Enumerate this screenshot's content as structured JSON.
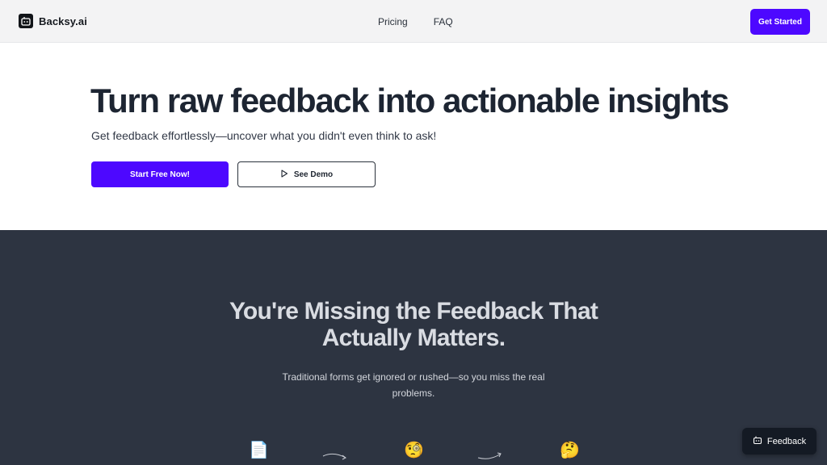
{
  "header": {
    "brand": "Backsy.ai",
    "nav": [
      "Pricing",
      "FAQ"
    ],
    "cta": "Get Started"
  },
  "hero": {
    "title": "Turn raw feedback into actionable insights",
    "subtitle": "Get feedback effortlessly—uncover what you didn't even think to ask!",
    "primary_button": "Start Free Now!",
    "secondary_button": "See Demo"
  },
  "problem": {
    "title_line1": "You're Missing the Feedback That",
    "title_line2": "Actually Matters.",
    "subtitle_line1": "Traditional forms get ignored or rushed—so you miss the real",
    "subtitle_line2": "problems.",
    "emojis": [
      "📄",
      "🧐",
      "🤔"
    ]
  },
  "floating": {
    "feedback_button": "Feedback"
  },
  "colors": {
    "accent": "#4d08ff",
    "dark_section": "#2d3441",
    "header_bg": "#f3f3f4"
  },
  "icons": [
    "bot-logo-icon",
    "play-icon",
    "curved-arrow-icon",
    "bot-icon"
  ]
}
